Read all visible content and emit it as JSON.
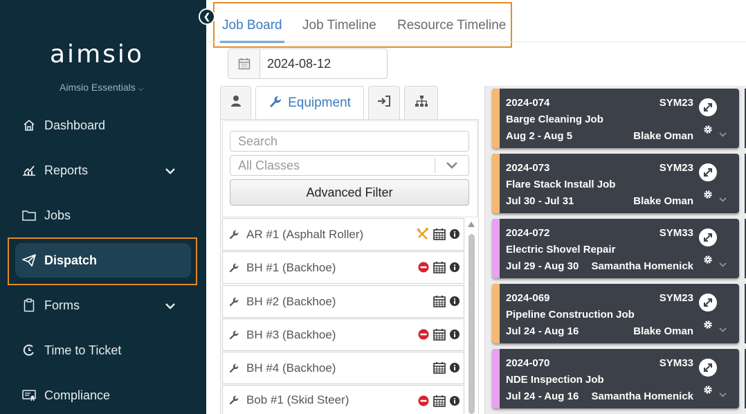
{
  "sidebar": {
    "logo": "aimsio",
    "subtitle": "Aimsio Essentials",
    "items": [
      {
        "label": "Dashboard",
        "icon": "home-icon"
      },
      {
        "label": "Reports",
        "icon": "chart-icon",
        "expandable": true
      },
      {
        "label": "Jobs",
        "icon": "folder-icon"
      },
      {
        "label": "Dispatch",
        "icon": "paper-plane-icon",
        "active": true
      },
      {
        "label": "Forms",
        "icon": "clipboard-icon",
        "expandable": true
      },
      {
        "label": "Time to Ticket",
        "icon": "clock-ticket-icon"
      },
      {
        "label": "Compliance",
        "icon": "certificate-icon"
      }
    ]
  },
  "tabs": [
    {
      "label": "Job Board",
      "active": true
    },
    {
      "label": "Job Timeline"
    },
    {
      "label": "Resource Timeline"
    }
  ],
  "date": {
    "value": "2024-08-12"
  },
  "resource_tabs": {
    "equipment_label": "Equipment",
    "icons": [
      "person-icon",
      "wrench-icon",
      "sign-in-icon",
      "sitemap-icon"
    ]
  },
  "filters": {
    "search_placeholder": "Search",
    "classes_value": "All Classes",
    "advanced_filter_label": "Advanced Filter"
  },
  "equipment": [
    {
      "name": "AR #1 (Asphalt Roller)",
      "status": "maintenance"
    },
    {
      "name": "BH #1 (Backhoe)",
      "status": "unavailable"
    },
    {
      "name": "BH #2 (Backhoe)",
      "status": "none"
    },
    {
      "name": "BH #3 (Backhoe)",
      "status": "unavailable"
    },
    {
      "name": "BH #4 (Backhoe)",
      "status": "none"
    },
    {
      "name": "Bob #1 (Skid Steer)",
      "status": "unavailable"
    }
  ],
  "jobs": [
    {
      "id": "2024-074",
      "code": "SYM23",
      "name": "Barge Cleaning Job",
      "dates": "Aug 2 - Aug 5",
      "person": "Blake Oman",
      "color": "#f5b971"
    },
    {
      "id": "2024-073",
      "code": "SYM23",
      "name": "Flare Stack Install Job",
      "dates": "Jul 30 - Jul 31",
      "person": "Blake Oman",
      "color": "#f5b971"
    },
    {
      "id": "2024-072",
      "code": "SYM33",
      "name": "Electric Shovel Repair",
      "dates": "Jul 29 - Aug 30",
      "person": "Samantha Homenick",
      "color": "#e7a2f0"
    },
    {
      "id": "2024-069",
      "code": "SYM23",
      "name": "Pipeline Construction Job",
      "dates": "Jul 24 - Aug 16",
      "person": "Blake Oman",
      "color": "#f5b971"
    },
    {
      "id": "2024-070",
      "code": "SYM33",
      "name": "NDE Inspection Job",
      "dates": "Jul 24 - Aug 16",
      "person": "Samantha Homenick",
      "color": "#e7a2f0"
    }
  ],
  "colors": {
    "sidebar_bg": "#0f2c3a",
    "accent": "#3a7bbf",
    "highlight": "#e78a24",
    "card_bg": "#3c4048",
    "unavailable": "#d9212c",
    "maintenance": "#f0a020"
  }
}
